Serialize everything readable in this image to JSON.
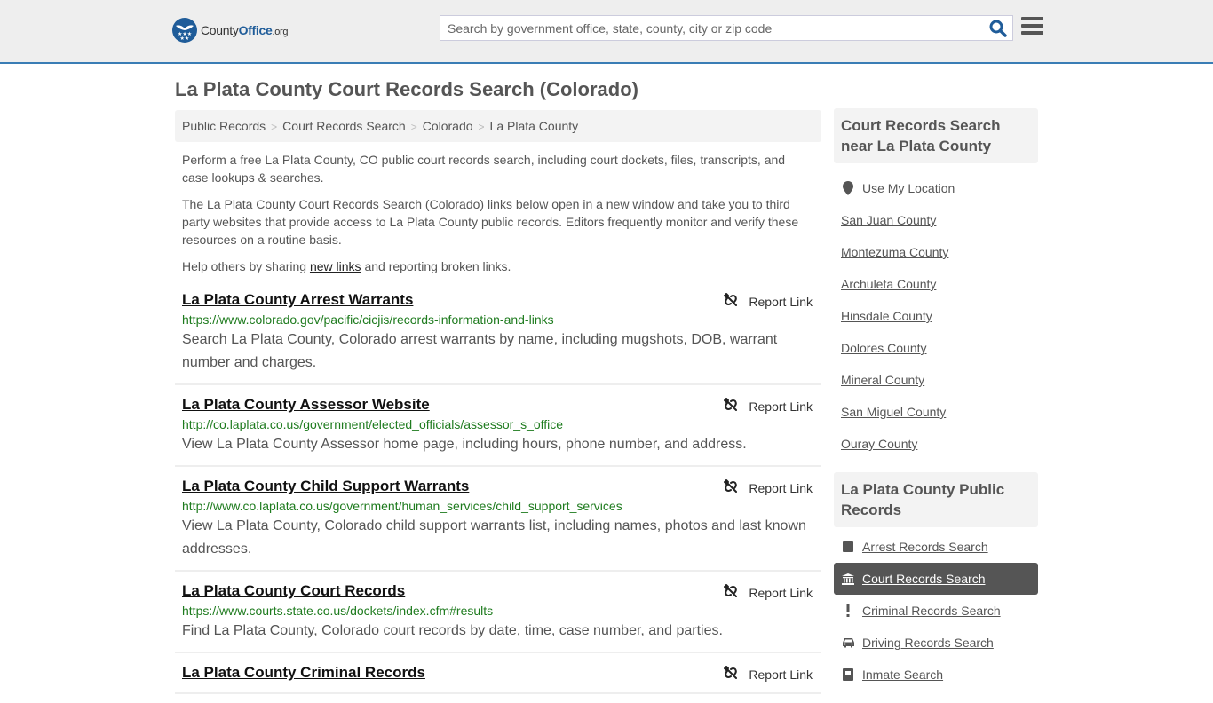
{
  "header": {
    "logo": {
      "name_part1": "County",
      "name_part2": "Office",
      "name_part3": ".org",
      "icon": "eagle-stars-badge-icon"
    },
    "search": {
      "placeholder": "Search by government office, state, county, city or zip code",
      "value": "",
      "icon": "search-icon"
    },
    "menu_icon": "hamburger-menu-icon"
  },
  "page": {
    "title": "La Plata County Court Records Search (Colorado)"
  },
  "breadcrumb": [
    {
      "label": "Public Records"
    },
    {
      "label": "Court Records Search"
    },
    {
      "label": "Colorado"
    },
    {
      "label": "La Plata County"
    }
  ],
  "breadcrumb_separator": ">",
  "intro": {
    "p1": "Perform a free La Plata County, CO public court records search, including court dockets, files, transcripts, and case lookups & searches.",
    "p2": "The La Plata County Court Records Search (Colorado) links below open in a new window and take you to third party websites that provide access to La Plata County public records. Editors frequently monitor and verify these resources on a routine basis.",
    "p3_before": "Help others by sharing ",
    "p3_link": "new links",
    "p3_after": " and reporting broken links."
  },
  "report_label": "Report Link",
  "links": [
    {
      "title": "La Plata County Arrest Warrants",
      "url": "https://www.colorado.gov/pacific/cicjis/records-information-and-links",
      "description": "Search La Plata County, Colorado arrest warrants by name, including mugshots, DOB, warrant number and charges."
    },
    {
      "title": "La Plata County Assessor Website",
      "url": "http://co.laplata.co.us/government/elected_officials/assessor_s_office",
      "description": "View La Plata County Assessor home page, including hours, phone number, and address."
    },
    {
      "title": "La Plata County Child Support Warrants",
      "url": "http://www.co.laplata.co.us/government/human_services/child_support_services",
      "description": "View La Plata County, Colorado child support warrants list, including names, photos and last known addresses."
    },
    {
      "title": "La Plata County Court Records",
      "url": "https://www.courts.state.co.us/dockets/index.cfm#results",
      "description": "Find La Plata County, Colorado court records by date, time, case number, and parties."
    },
    {
      "title": "La Plata County Criminal Records",
      "url": "",
      "description": ""
    }
  ],
  "sidebar": {
    "nearby": {
      "heading": "Court Records Search near La Plata County",
      "use_location": "Use My Location",
      "counties": [
        "San Juan County",
        "Montezuma County",
        "Archuleta County",
        "Hinsdale County",
        "Dolores County",
        "Mineral County",
        "San Miguel County",
        "Ouray County"
      ]
    },
    "public_records": {
      "heading": "La Plata County Public Records",
      "items": [
        {
          "label": "Arrest Records Search",
          "icon": "square-icon",
          "active": false
        },
        {
          "label": "Court Records Search",
          "icon": "courthouse-icon",
          "active": true
        },
        {
          "label": "Criminal Records Search",
          "icon": "exclamation-icon",
          "active": false
        },
        {
          "label": "Driving Records Search",
          "icon": "car-icon",
          "active": false
        },
        {
          "label": "Inmate Search",
          "icon": "inmate-icon",
          "active": false
        }
      ]
    }
  },
  "colors": {
    "header_bg": "#eeeeee",
    "header_border": "#3a7db5",
    "brand_blue": "#1f5c99",
    "url_green": "#1e7b1e",
    "active_bg": "#555555"
  }
}
